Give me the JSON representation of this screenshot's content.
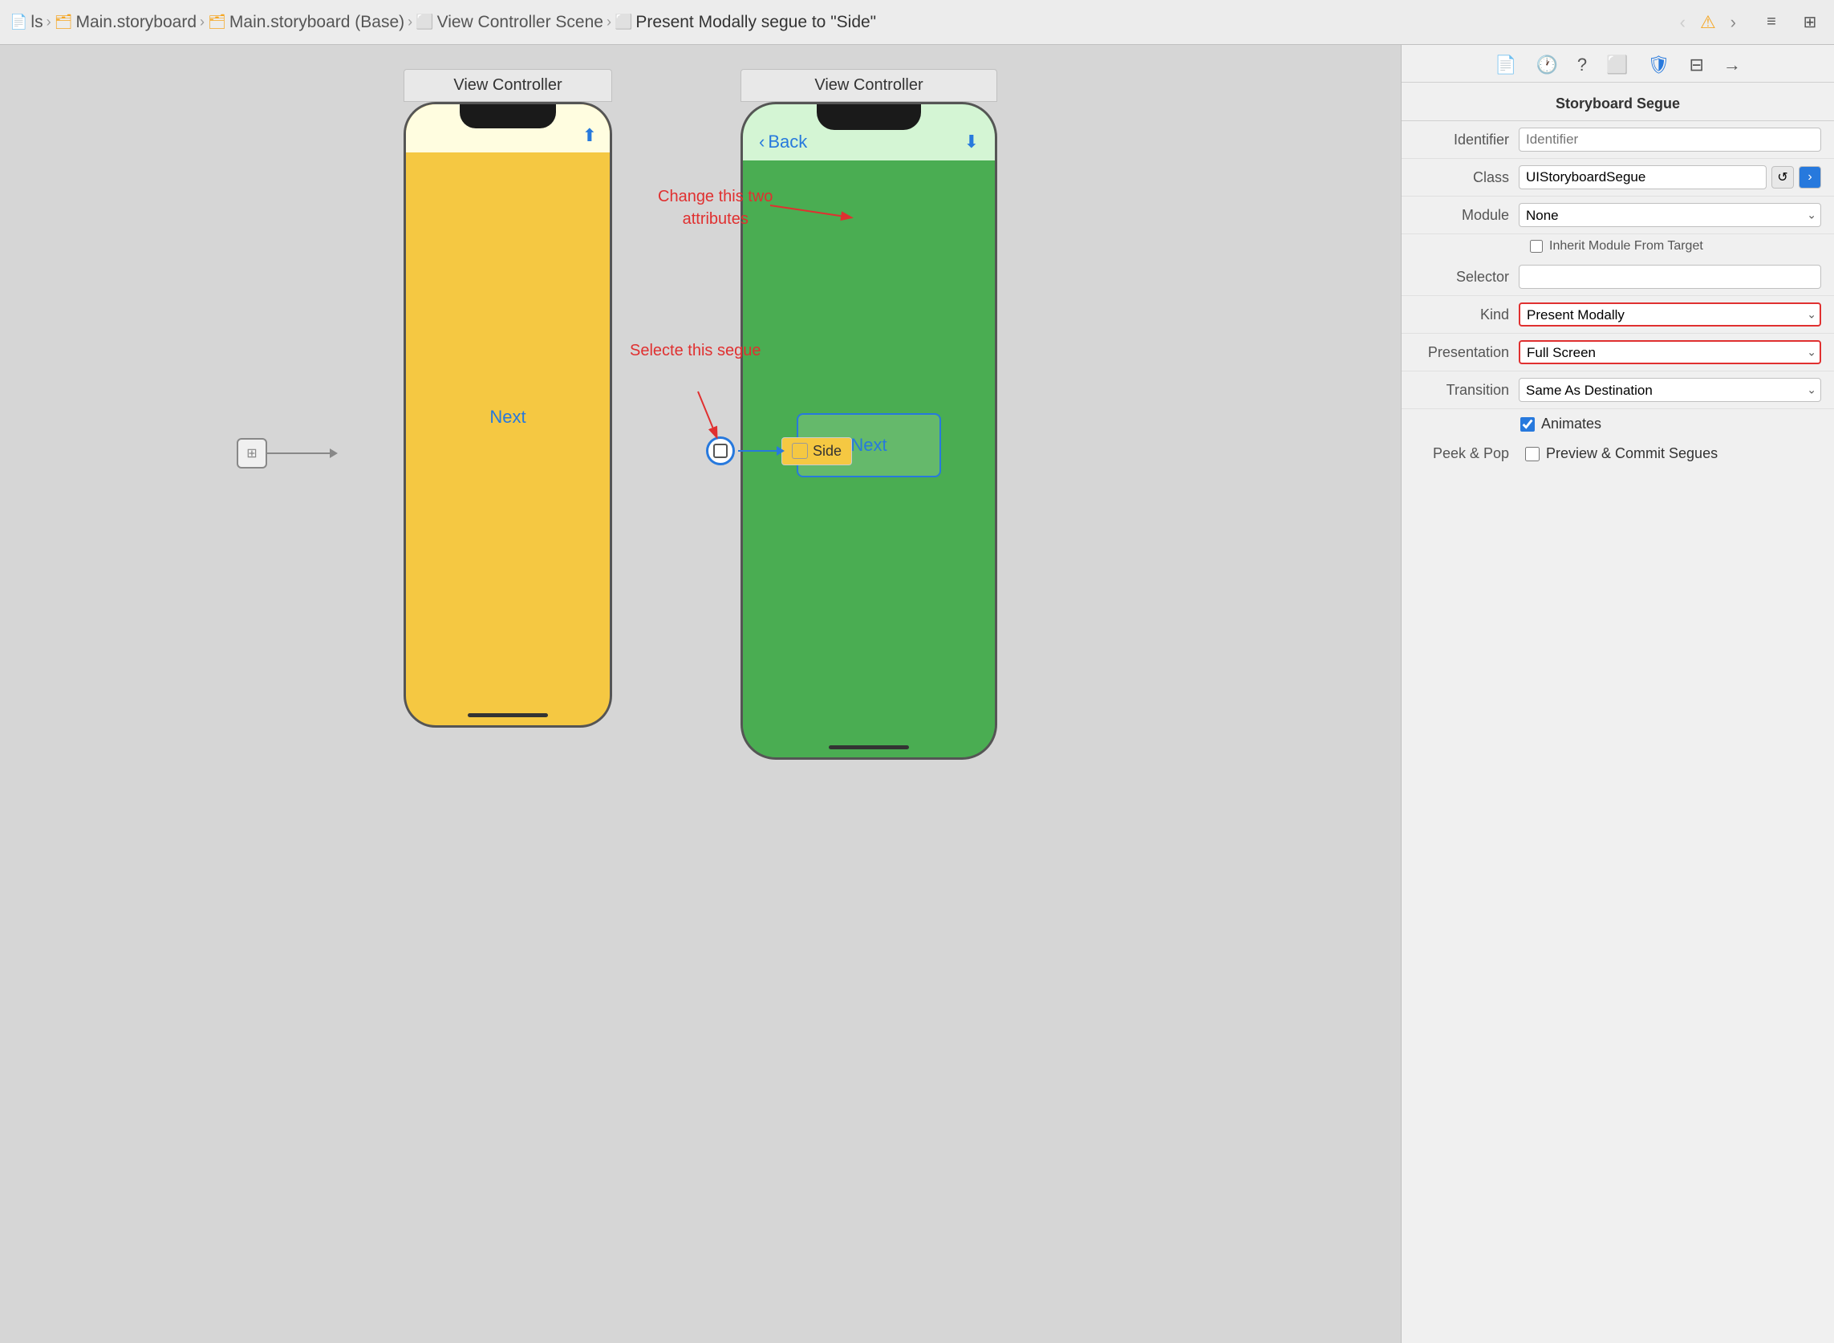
{
  "topbar": {
    "breadcrumbs": [
      "ls",
      "Main.storyboard",
      "Main.storyboard (Base)",
      "View Controller Scene",
      "Present Modally segue to \"Side\""
    ]
  },
  "canvas": {
    "vc1_label": "View Controller",
    "vc2_label": "View Controller",
    "phone1": {
      "next_label": "Next"
    },
    "phone2": {
      "back_label": "Back",
      "next_button_label": "Next"
    },
    "side_badge_label": "Side",
    "annotation1": "Change this two\nattributes",
    "annotation2": "Selecte this segue"
  },
  "inspector": {
    "title": "Storyboard Segue",
    "identifier_label": "Identifier",
    "identifier_placeholder": "Identifier",
    "class_label": "Class",
    "class_value": "UIStoryboardSegue",
    "module_label": "Module",
    "module_value": "None",
    "inherit_label": "Inherit Module From Target",
    "selector_label": "Selector",
    "kind_label": "Kind",
    "kind_value": "Present Modally",
    "presentation_label": "Presentation",
    "presentation_value": "Full Screen",
    "transition_label": "Transition",
    "transition_value": "Same As Destination",
    "animates_label": "Animates",
    "peek_label": "Peek & Pop",
    "peek_checkbox_label": "Preview & Commit Segues",
    "top_icons": [
      "doc-icon",
      "clock-icon",
      "question-icon",
      "square-icon",
      "shield-icon",
      "slider-icon",
      "arrow-icon"
    ]
  }
}
